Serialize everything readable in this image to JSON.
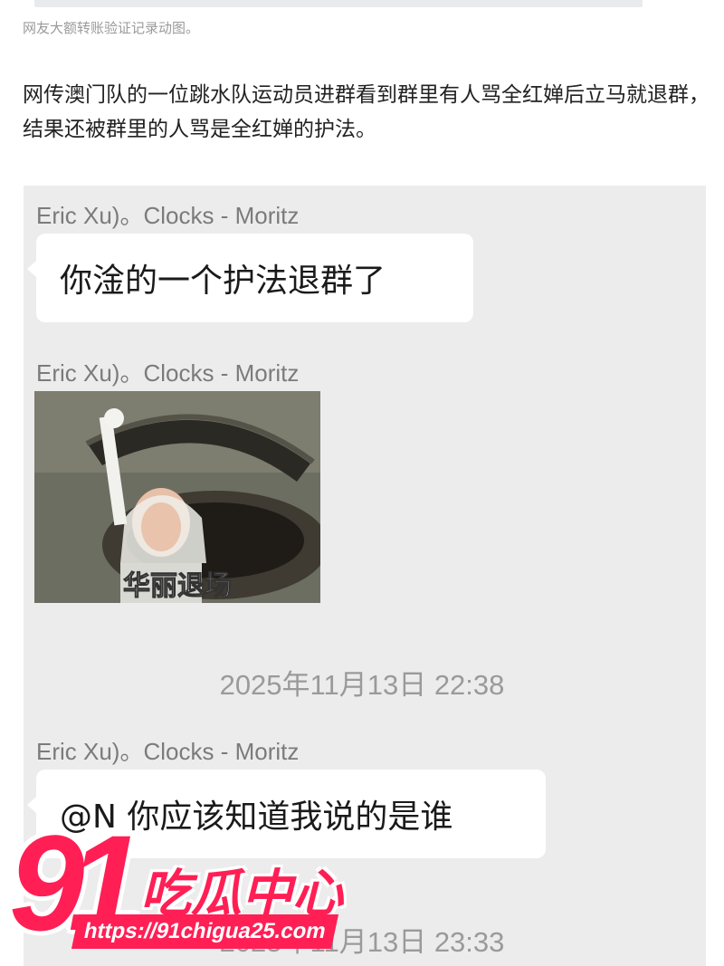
{
  "caption": "网友大额转账验证记录动图。",
  "article": {
    "paragraph": "网传澳门队的一位跳水队运动员进群看到群里有人骂全红婵后立马就退群，结果还被群里的人骂是全红婵的护法。"
  },
  "chat": {
    "messages": [
      {
        "sender": "Eric Xu)。Clocks - Moritz",
        "text": "你淦的一个护法退群了"
      },
      {
        "sender": "Eric Xu)。Clocks - Moritz",
        "image_caption": "华丽退场"
      },
      {
        "sender": "Eric Xu)。Clocks - Moritz",
        "text": "@N 你应该知道我说的是谁"
      }
    ],
    "timestamps": [
      "2025年11月13日 22:38",
      "2025年11月13日 23:33"
    ]
  },
  "watermark": {
    "number": "91",
    "tag": "吃瓜中心",
    "url": "https://91chigua25.com",
    "color": "#ff1f55"
  }
}
